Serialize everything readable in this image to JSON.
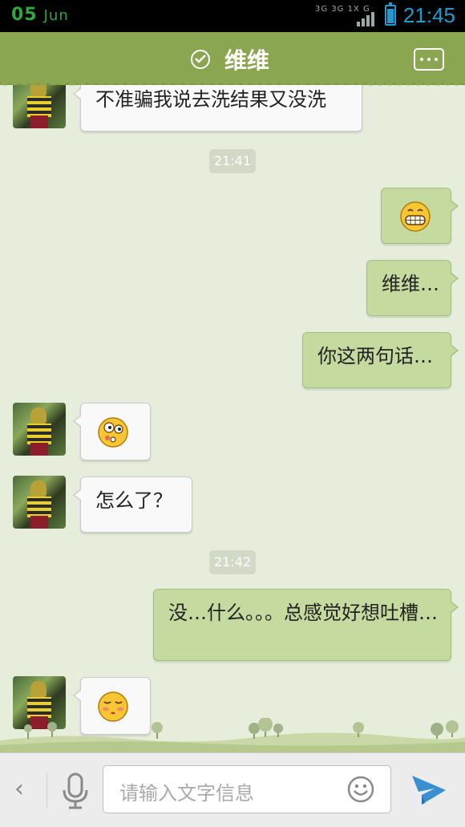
{
  "status_bar": {
    "day": "05",
    "month": "Jun",
    "network": "3G 3G 1X G",
    "time": "21:45"
  },
  "header": {
    "title": "维维",
    "verified_icon": "check-circle-icon",
    "menu_icon": "more-dots-icon"
  },
  "messages": [
    {
      "side": "left",
      "type": "text",
      "text": "不准骗我说去洗结果又没洗"
    },
    {
      "type": "timestamp",
      "text": "21:41"
    },
    {
      "side": "right",
      "type": "emoji",
      "emoji": "grin-emoji-icon"
    },
    {
      "side": "right",
      "type": "text",
      "text": "维维…"
    },
    {
      "side": "right",
      "type": "text",
      "text": "你这两句话…"
    },
    {
      "side": "left",
      "type": "emoji",
      "emoji": "dizzy-eyes-emoji-icon"
    },
    {
      "side": "left",
      "type": "text",
      "text": "怎么了？"
    },
    {
      "type": "timestamp",
      "text": "21:42"
    },
    {
      "side": "right",
      "type": "text",
      "text": "没…什么。。。总感觉好想吐槽…"
    },
    {
      "side": "left",
      "type": "emoji",
      "emoji": "blush-emoji-icon"
    }
  ],
  "input_bar": {
    "placeholder": "请输入文字信息",
    "back_icon": "chevron-left-icon",
    "voice_icon": "microphone-icon",
    "emoji_icon": "smiley-icon",
    "send_icon": "send-icon"
  },
  "colors": {
    "header": "#8aa650",
    "chat_background": "#e6eedb",
    "outgoing_bubble": "#c5da9e",
    "incoming_bubble": "#f9f9f9",
    "time_text": "#1e9bd1"
  }
}
